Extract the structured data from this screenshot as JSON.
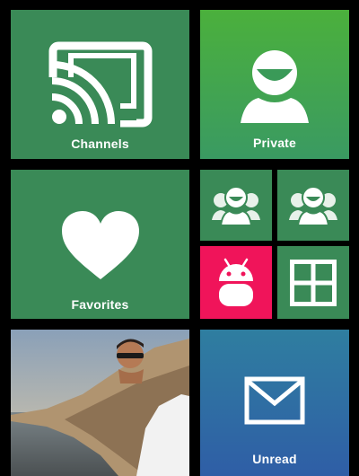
{
  "tiles": {
    "channels": {
      "label": "Channels",
      "icon": "cast-icon"
    },
    "private": {
      "label": "Private",
      "icon": "user-icon"
    },
    "favorites": {
      "label": "Favorites",
      "icon": "heart-icon"
    },
    "group_one": {
      "icon": "group-icon"
    },
    "group_two": {
      "icon": "group-icon"
    },
    "android": {
      "icon": "android-icon"
    },
    "grid": {
      "icon": "grid-icon"
    },
    "photo": {
      "icon": "profile-photo"
    },
    "unread": {
      "label": "Unread",
      "icon": "mail-icon"
    }
  },
  "colors": {
    "background": "#000000",
    "tile_green": "#3a8a57",
    "private_gradient_top": "#4bb03c",
    "private_gradient_bottom": "#3a9a62",
    "android_pink": "#f0145a",
    "unread_gradient_top": "#2f7ea0",
    "unread_gradient_bottom": "#2f5ea6"
  }
}
